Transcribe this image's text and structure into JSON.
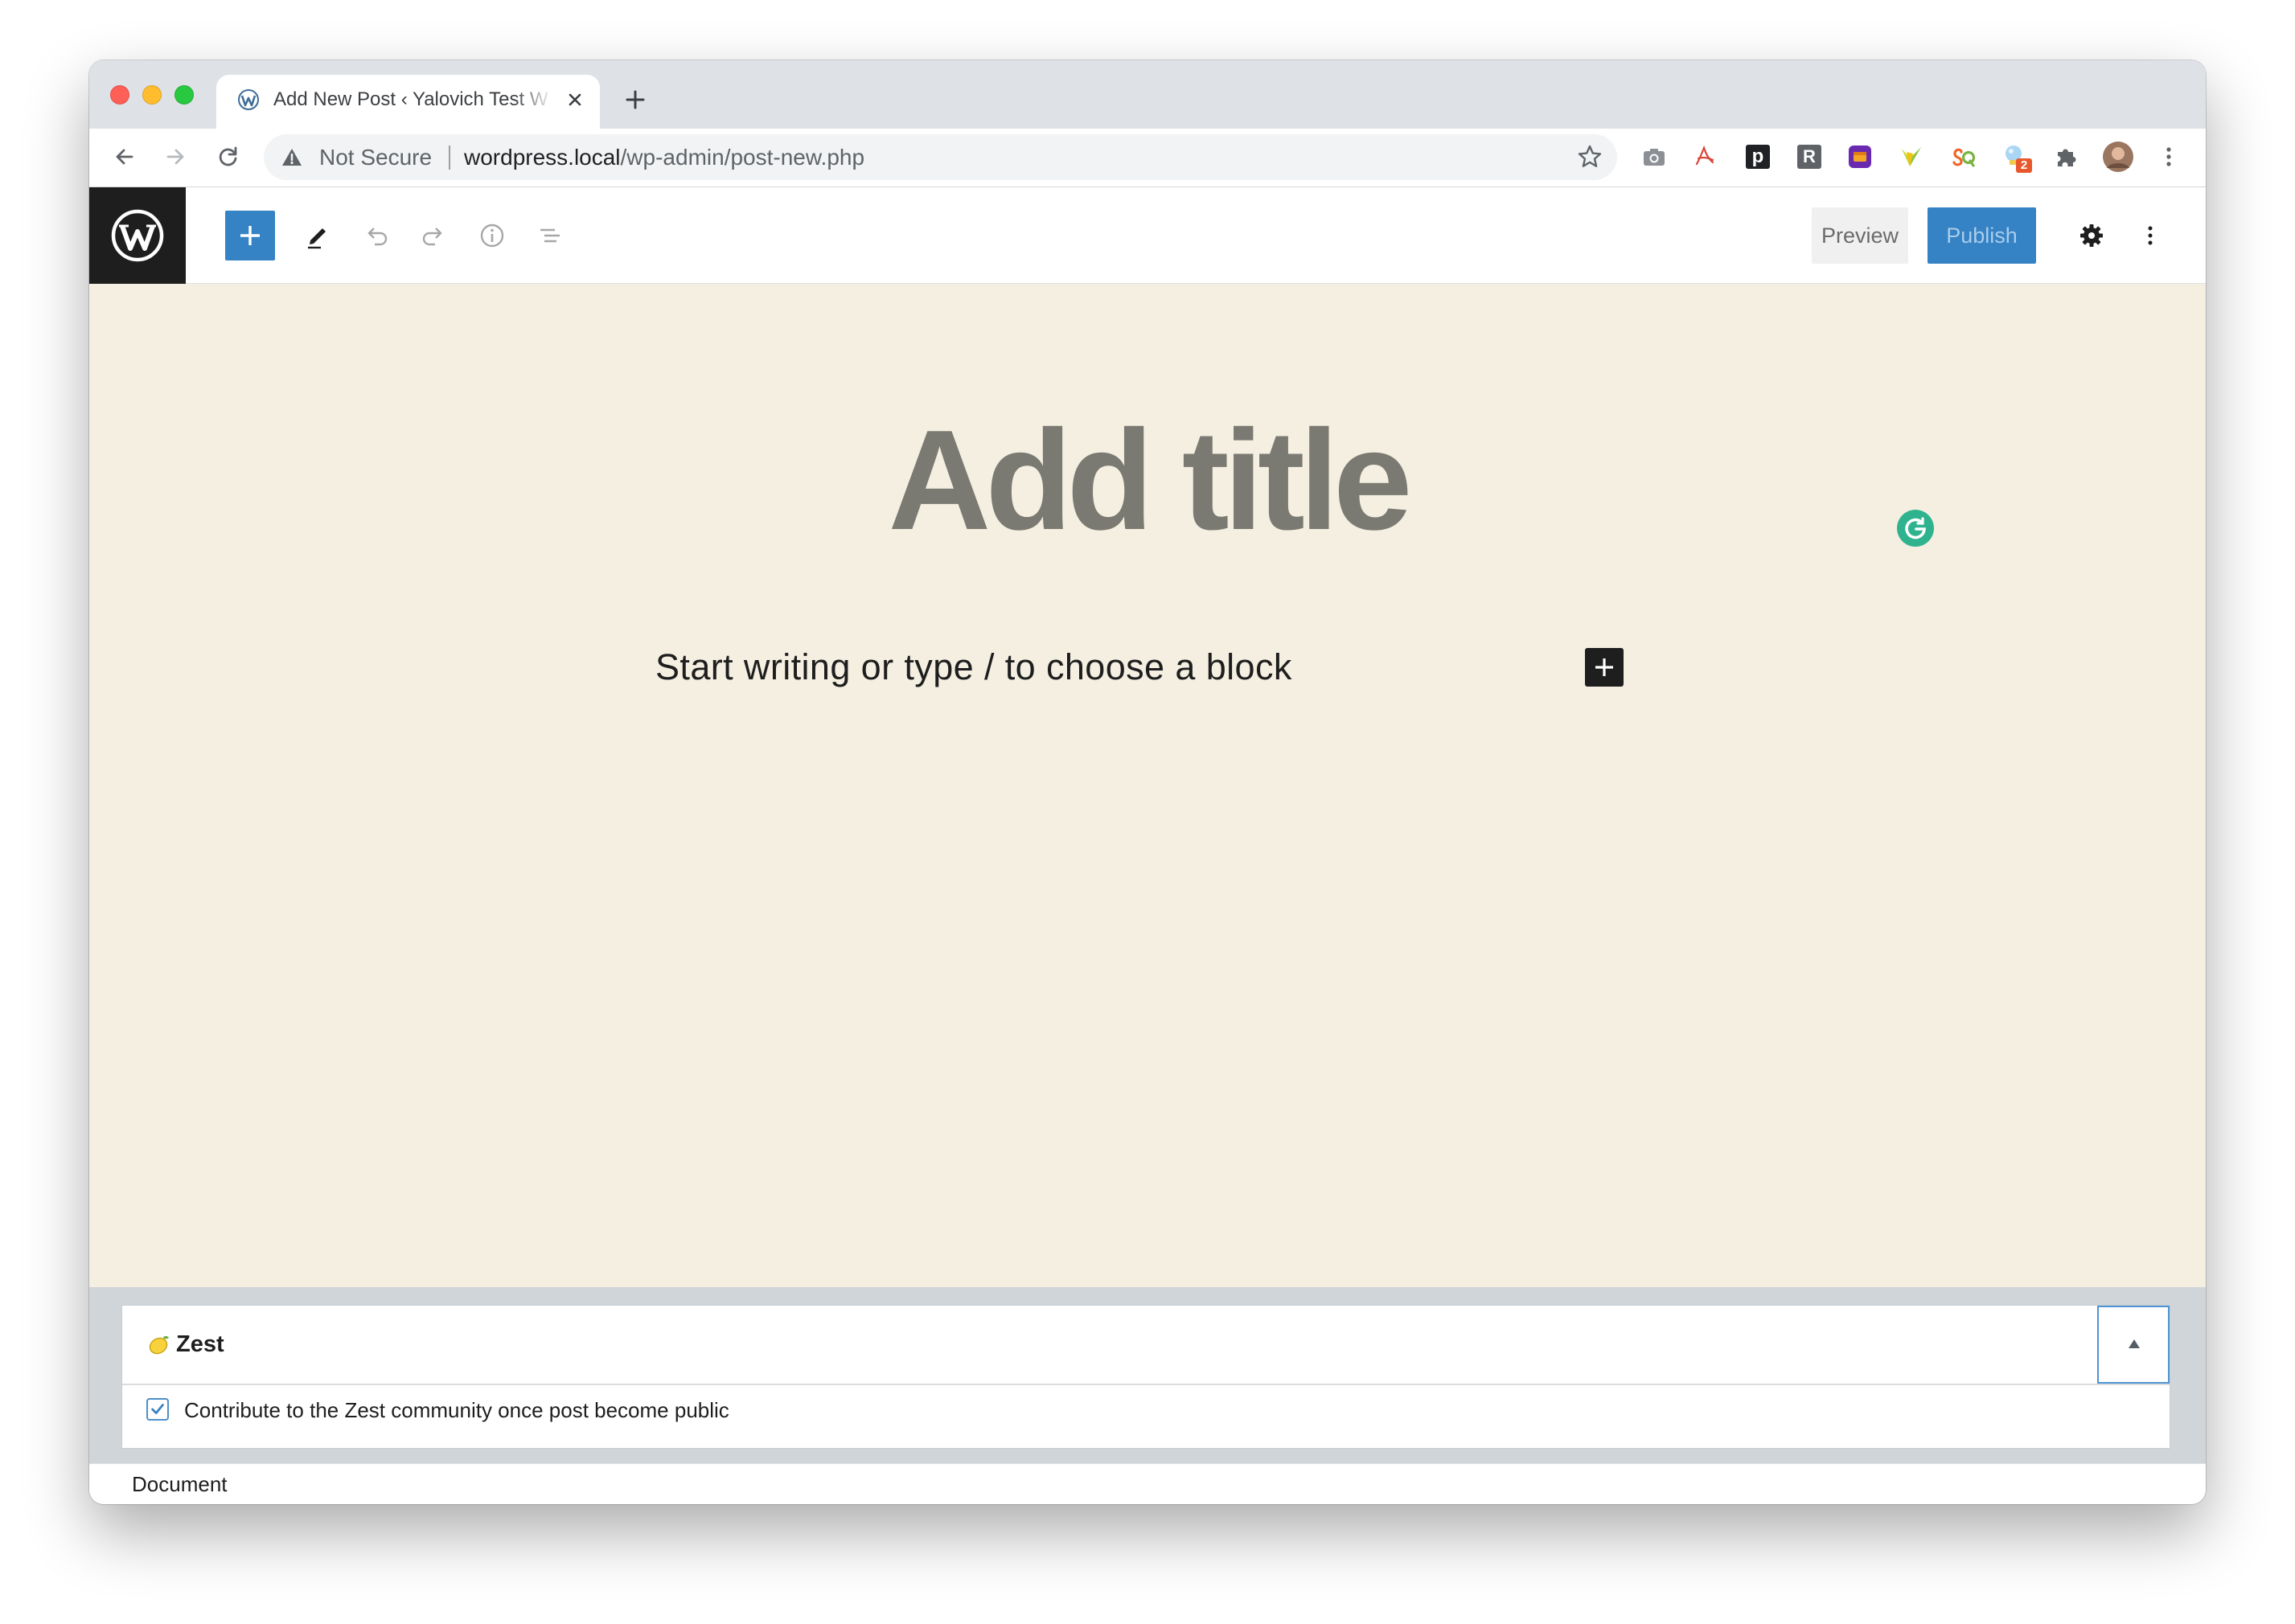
{
  "tab": {
    "title": "Add New Post ‹ Yalovich Test W",
    "favicon": "wordpress-icon"
  },
  "omnibox": {
    "security_text": "Not Secure",
    "url_host": "wordpress.local",
    "url_path": "/wp-admin/post-new.php"
  },
  "extensions": {
    "icons": [
      "camera-icon",
      "red-swoosh-extension-icon",
      "p-extension-icon",
      "r-extension-icon",
      "purple-box-extension-icon",
      "leaf-extension-icon",
      "orange-green-extension-icon",
      "lightbulb-extension-icon",
      "puzzle-icon",
      "avatar",
      "chrome-menu-icon"
    ],
    "p_letter": "p",
    "r_letter": "R",
    "bulb_badge": "2"
  },
  "wp_toolbar": {
    "icons": [
      "wordpress-logo",
      "add-block-icon",
      "edit-tool-icon",
      "undo-icon",
      "redo-icon",
      "info-icon",
      "outline-icon",
      "settings-gear-icon",
      "more-options-icon"
    ],
    "preview_label": "Preview",
    "publish_label": "Publish"
  },
  "editor": {
    "title_placeholder": "Add title",
    "body_placeholder": "Start writing or type / to choose a block"
  },
  "metabox": {
    "icon": "lemon-icon",
    "title": "Zest",
    "option_label": "Contribute to the Zest community once post become public",
    "option_checked": true
  },
  "footer": {
    "breadcrumb": "Document"
  },
  "colors": {
    "accent": "#3582c4",
    "canvas": "#f4efe1",
    "grammarly": "#2fb38e"
  }
}
